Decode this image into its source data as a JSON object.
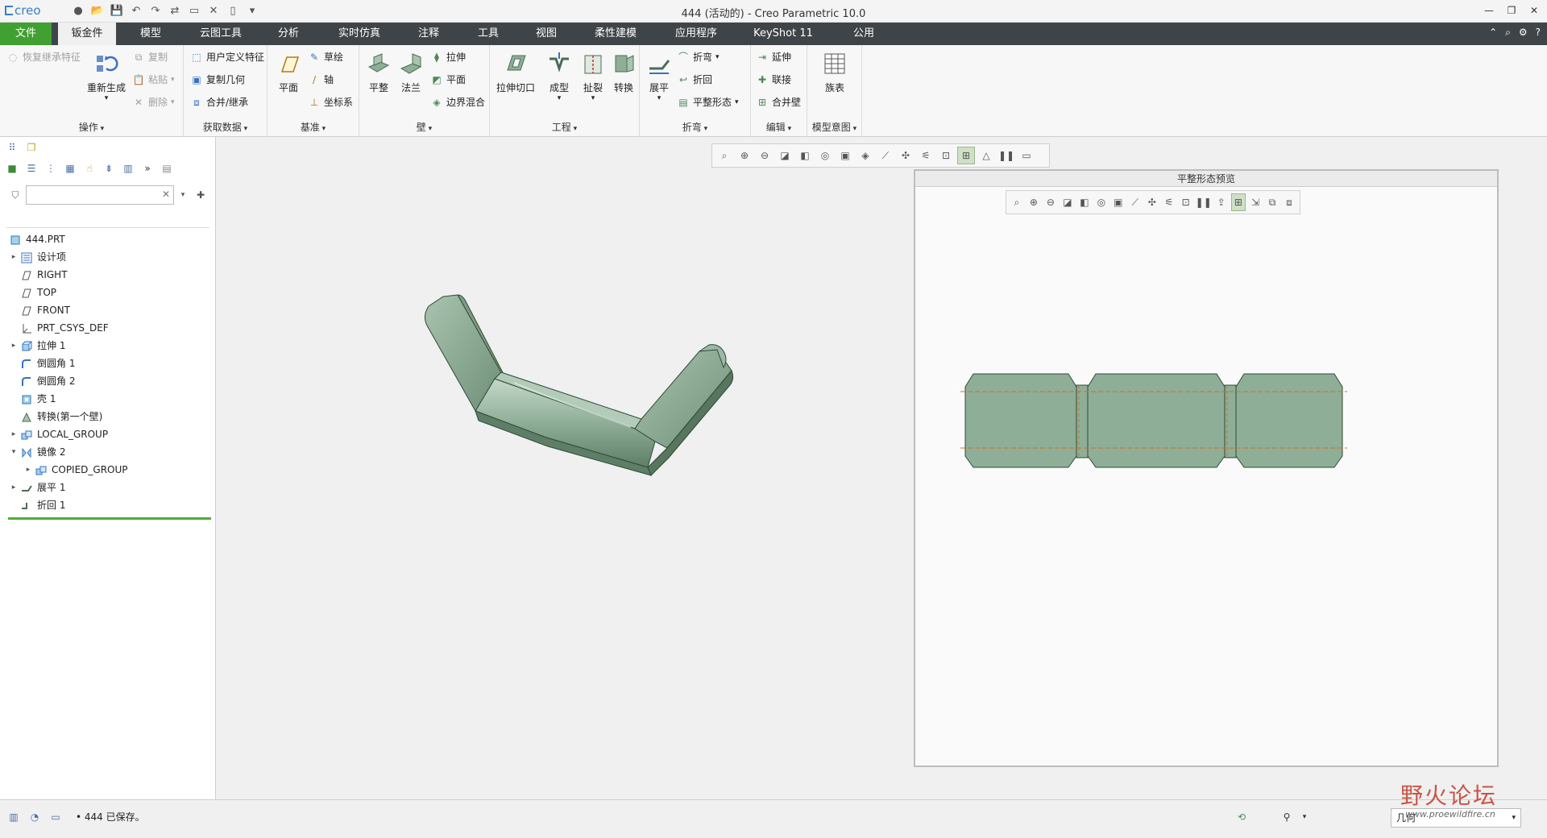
{
  "window": {
    "app_logo": "creo",
    "title": "444 (活动的) - Creo Parametric 10.0"
  },
  "menu": {
    "tabs": [
      "文件",
      "钣金件",
      "模型",
      "云图工具",
      "分析",
      "实时仿真",
      "注释",
      "工具",
      "视图",
      "柔性建模",
      "应用程序",
      "KeyShot 11",
      "公用"
    ],
    "active_tab": "钣金件"
  },
  "ribbon": {
    "operations": {
      "label": "操作",
      "restore": "恢复继承特征",
      "regenerate": "重新生成",
      "copy": "复制",
      "paste": "粘贴",
      "delete": "删除"
    },
    "get_data": {
      "label": "获取数据",
      "udf": "用户定义特征",
      "copy_geom": "复制几何",
      "merge": "合并/继承"
    },
    "datum": {
      "label": "基准",
      "plane": "平面",
      "sketch": "草绘",
      "axis": "轴",
      "csys": "坐标系"
    },
    "wall": {
      "label": "壁",
      "planar": "平整",
      "flange": "法兰",
      "extrude": "拉伸",
      "plane": "平面",
      "boundary": "边界混合"
    },
    "engineering": {
      "label": "工程",
      "extrude_cut": "拉伸切口",
      "form": "成型",
      "rip": "扯裂",
      "convert": "转换"
    },
    "bend": {
      "label": "折弯",
      "unbend": "展平",
      "bend": "折弯",
      "bend_back": "折回",
      "flat_state": "平整形态"
    },
    "edit": {
      "label": "编辑",
      "extend": "延伸",
      "join": "联接",
      "merge_walls": "合并壁"
    },
    "model_intent": {
      "label": "模型意图",
      "family_table": "族表"
    }
  },
  "model_tree": {
    "search_placeholder": "",
    "root": "444.PRT",
    "items": [
      {
        "label": "设计项",
        "expandable": true,
        "icon": "design-items-icon"
      },
      {
        "label": "RIGHT",
        "expandable": false,
        "icon": "datum-plane-icon"
      },
      {
        "label": "TOP",
        "expandable": false,
        "icon": "datum-plane-icon"
      },
      {
        "label": "FRONT",
        "expandable": false,
        "icon": "datum-plane-icon"
      },
      {
        "label": "PRT_CSYS_DEF",
        "expandable": false,
        "icon": "csys-icon"
      },
      {
        "label": "拉伸 1",
        "expandable": true,
        "icon": "extrude-icon"
      },
      {
        "label": "倒圆角 1",
        "expandable": false,
        "icon": "round-icon"
      },
      {
        "label": "倒圆角 2",
        "expandable": false,
        "icon": "round-icon"
      },
      {
        "label": "壳 1",
        "expandable": false,
        "icon": "shell-icon"
      },
      {
        "label": "转换(第一个壁)",
        "expandable": false,
        "icon": "convert-icon"
      },
      {
        "label": "LOCAL_GROUP",
        "expandable": true,
        "icon": "group-icon"
      },
      {
        "label": "镜像 2",
        "expandable": true,
        "expanded": true,
        "icon": "mirror-icon"
      },
      {
        "label": "COPIED_GROUP",
        "expandable": true,
        "indent": true,
        "icon": "group-icon"
      },
      {
        "label": "展平 1",
        "expandable": true,
        "icon": "unbend-icon"
      },
      {
        "label": "折回 1",
        "expandable": false,
        "icon": "bendback-icon"
      }
    ]
  },
  "preview": {
    "title": "平整形态预览"
  },
  "status": {
    "message": "• 444 已保存。",
    "filter": "几何"
  },
  "watermark": {
    "text": "野火论坛",
    "url": "www.proewildfire.cn"
  },
  "colors": {
    "accent_green": "#41a032",
    "menubar": "#3f4448",
    "part_fill": "#8fae98"
  }
}
